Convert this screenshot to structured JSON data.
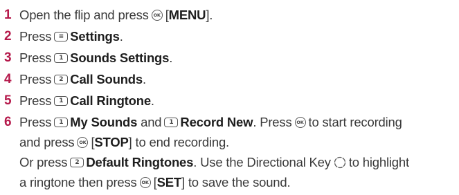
{
  "icons": {
    "ok_key": "ok-key-icon",
    "menu_key": "menu-key-icon",
    "key_1": "key-1-icon",
    "key_2": "key-2-icon",
    "directional_key": "directional-key-icon"
  },
  "key_labels": {
    "ok": "OK",
    "menu": "≡",
    "one": "1",
    "two": "2"
  },
  "colors": {
    "step_number": "#b5194b",
    "text": "#3a3a3a"
  },
  "steps": [
    {
      "number": "1",
      "t1": "Open the flip and press",
      "t2": "[",
      "b1": "MENU",
      "t3": "]."
    },
    {
      "number": "2",
      "t1": "Press",
      "b1": "Settings",
      "t2": "."
    },
    {
      "number": "3",
      "t1": "Press",
      "b1": "Sounds Settings",
      "t2": "."
    },
    {
      "number": "4",
      "t1": "Press",
      "b1": "Call Sounds",
      "t2": "."
    },
    {
      "number": "5",
      "t1": "Press",
      "b1": "Call Ringtone",
      "t2": "."
    },
    {
      "number": "6",
      "l1_t1": "Press",
      "l1_b1": "My Sounds",
      "l1_t2": "and",
      "l1_b2": "Record New",
      "l1_t3": ". Press",
      "l1_t4": "to start recording",
      "l2_t1": "and press",
      "l2_t2": "[",
      "l2_b1": "STOP",
      "l2_t3": "] to end recording.",
      "l3_t1": "Or press",
      "l3_b1": "Default Ringtones",
      "l3_t2": ". Use the Directional Key",
      "l3_t3": "to highlight",
      "l4_t1": "a ringtone then press",
      "l4_t2": "[",
      "l4_b1": "SET",
      "l4_t3": "] to save the sound."
    }
  ]
}
